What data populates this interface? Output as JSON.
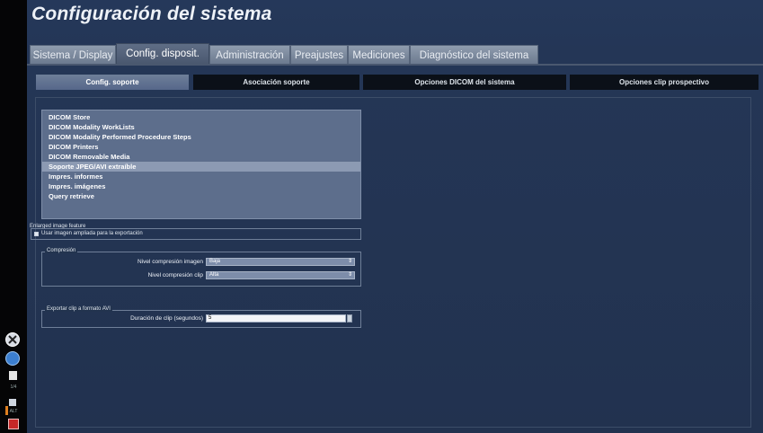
{
  "title": "Configuración del sistema",
  "tabs": [
    {
      "label": "Sistema / Display"
    },
    {
      "label": "Config. disposit."
    },
    {
      "label": "Administración"
    },
    {
      "label": "Preajustes"
    },
    {
      "label": "Mediciones"
    },
    {
      "label": "Diagnóstico del sistema"
    }
  ],
  "active_tab": "Config. disposit.",
  "subtabs": [
    {
      "label": "Config. soporte"
    },
    {
      "label": "Asociación soporte"
    },
    {
      "label": "Opciones DICOM del sistema"
    },
    {
      "label": "Opciones clip prospectivo"
    }
  ],
  "active_subtab": "Config. soporte",
  "media_list": [
    "DICOM Store",
    "DICOM Modality WorkLists",
    "DICOM Modality Performed Procedure Steps",
    "DICOM Printers",
    "DICOM Removable Media",
    "Soporte JPEG/AVI extraíble",
    "Impres. informes",
    "Impres. imágenes",
    "Query retrieve"
  ],
  "selected_media": "Soporte JPEG/AVI extraíble",
  "enlarged": {
    "group_label": "Enlarged image feature",
    "checkbox_label": "Usar imagen ampliada para la exportación"
  },
  "compression": {
    "group_label": "Compresión",
    "image_label": "Nivel compresión imagen",
    "image_value": "Baja",
    "clip_label": "Nivel compresión clip",
    "clip_value": "Alta"
  },
  "avi_export": {
    "group_label": "Exportar clip a formato AVI",
    "duration_label": "Duración de clip (segundos)",
    "duration_value": "5"
  },
  "left_panel": {
    "small_labels": [
      "1/4",
      "ALT"
    ]
  }
}
